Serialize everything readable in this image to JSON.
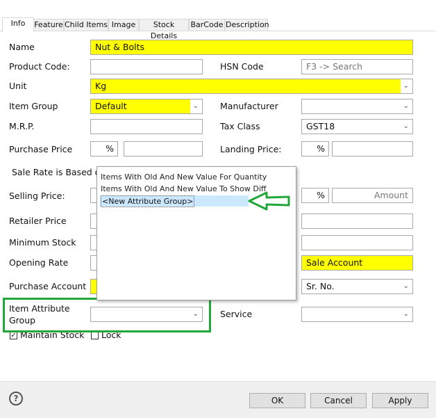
{
  "tabs": [
    "Info",
    "Feature",
    "Child Items",
    "Image",
    "Stock Details",
    "BarCode",
    "Description"
  ],
  "form": {
    "name_label": "Name",
    "name_value": "Nut & Bolts",
    "product_code_label": "Product Code:",
    "product_code_value": "",
    "hsn_label": "HSN Code",
    "hsn_placeholder": "F3 -> Search",
    "unit_label": "Unit",
    "unit_value": "Kg",
    "item_group_label": "Item Group",
    "item_group_value": "Default",
    "manufacturer_label": "Manufacturer",
    "manufacturer_value": "",
    "mrp_label": "M.R.P.",
    "tax_class_label": "Tax Class",
    "tax_class_value": "GST18",
    "purchase_price_label": "Purchase Price",
    "percent": "%",
    "landing_price_label": "Landing Price:",
    "sale_rate_label": "Sale Rate is Based o",
    "selling_price_label": "Selling Price:",
    "amount_placeholder": "Amount",
    "retailer_price_label": "Retailer Price",
    "minimum_stock_label": "Minimum Stock",
    "opening_rate_label": "Opening Rate",
    "sale_account_value": "Sale Account",
    "purchase_account_label": "Purchase Account",
    "sr_no_value": "Sr. No.",
    "item_attribute_group_label_1": "Item Attribute",
    "item_attribute_group_label_2": "Group",
    "service_label": "Service",
    "maintain_stock_label": "Maintain Stock",
    "maintain_stock_checked": true,
    "lock_label": "Lock",
    "lock_checked": false
  },
  "dropdown": {
    "items": [
      "Items With Old And New Value For Quantity",
      "Items With Old And New Value To Show Diff",
      "<New Attribute Group>"
    ],
    "selected_index": 2
  },
  "highlight_color": "#22a83a",
  "footer": {
    "ok": "OK",
    "cancel": "Cancel",
    "apply": "Apply",
    "help": "?"
  }
}
